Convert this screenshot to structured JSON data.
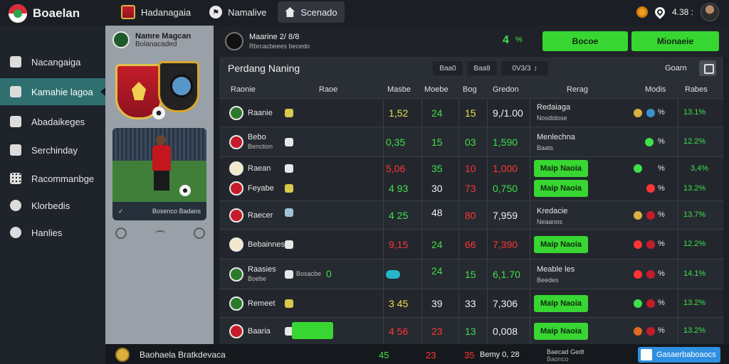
{
  "brand": {
    "name": "Boaelan"
  },
  "topnav": [
    {
      "label": "Hadanagaia"
    },
    {
      "label": "Namalive"
    },
    {
      "label": "Scenado"
    }
  ],
  "topright": {
    "balance": "4.38 :"
  },
  "sidebar": {
    "items": [
      {
        "label": "Nacangaiga"
      },
      {
        "label": "Kamahie lagoa"
      },
      {
        "label": "Abadaikeges"
      },
      {
        "label": "Serchinday"
      },
      {
        "label": "Racommanbge"
      },
      {
        "label": "Klorbedis"
      },
      {
        "label": "Hanlies"
      }
    ],
    "active_index": 1
  },
  "match_panel": {
    "title": "Namre Magcan",
    "subtitle": "Bolanacaded",
    "card_caption": "Bosenco Badaos"
  },
  "match_header": {
    "title": "Maarine 2/ 8/8",
    "subtitle": "Rbrcacbeees becedo",
    "odds": "4",
    "odds_pct": "%",
    "btn_primary": "Bocoe",
    "btn_secondary": "Mionaeie"
  },
  "table": {
    "title": "Perdang Naning",
    "filters": [
      "Baa0",
      "Baa8",
      "0V3/3"
    ],
    "search_label": "Goarn",
    "columns": [
      "Raonie",
      "Raoe",
      "Masbe",
      "Moebe",
      "Bog",
      "Gredon",
      "Rerag",
      "Modis",
      "Rabes"
    ],
    "rows": [
      {
        "team": "Raanie",
        "team2": "",
        "c1": "1,52",
        "c2": "24",
        "c3": "15",
        "c4": "9,/1.00",
        "info": "Redaiaga",
        "info_sub": "Nosdidose",
        "btn": "",
        "mod": "%",
        "rate": "13.1%"
      },
      {
        "team": "Bebo",
        "team2": "Benction",
        "c1": "0,35",
        "c2": "15",
        "c3": "03",
        "c4": "1,590",
        "info": "Menlechna",
        "info_sub": "Baats",
        "btn": "",
        "mod": "%",
        "rate": "12.2%"
      },
      {
        "team": "Raean",
        "team2": "Feyabe",
        "c1": "5,06",
        "c1b": "4 93",
        "c2": "35",
        "c2b": "30",
        "c3": "10",
        "c3b": "73",
        "c4": "1,000",
        "c4b": "0,750",
        "info": "",
        "info_sub": "",
        "btn": "Maip Naoia",
        "btn2": "Maip Naoia",
        "mod": "%",
        "mod2": "%",
        "rate": "3,4%",
        "rate2": "13.2%"
      },
      {
        "team": "Raecer",
        "team2": "",
        "c1": "4 25",
        "c2": "48",
        "c3": "80",
        "c4": "7,959",
        "info": "Kredacie",
        "info_sub": "Neaanos",
        "btn": "",
        "mod": "%",
        "rate": "13.7%"
      },
      {
        "team": "Bebainnes",
        "team2": "",
        "c1": "9,15",
        "c2": "24",
        "c3": "66",
        "c4": "7,390",
        "info": "",
        "info_sub": "",
        "btn": "Maip Naoia",
        "mod": "%",
        "rate": "12.2%"
      },
      {
        "team": "Raasies",
        "team2": "Boebe",
        "c1": "",
        "c2": "24",
        "c3": "15",
        "c4": "6,1.70",
        "info": "Meable les",
        "info_sub": "Beedes",
        "btn": "",
        "mod": "%",
        "rate": "14.1%",
        "badge_text": "Bosacbe",
        "badge_num": "0"
      },
      {
        "team": "Remeet",
        "team2": "",
        "c1": "3 45",
        "c2": "39",
        "c3": "33",
        "c4": "7,306",
        "info": "",
        "info_sub": "",
        "btn": "Maip Naoia",
        "mod": "%",
        "rate": "13.2%"
      },
      {
        "team": "Baaria",
        "team2": "",
        "c1": "4 56",
        "c2": "23",
        "c3": "13",
        "c4": "0,008",
        "info": "",
        "info_sub": "",
        "btn": "Maip Naoia",
        "mod": "%",
        "rate": "13.2%"
      }
    ]
  },
  "bottombar": {
    "title": "Baohaela Bratkdevaca",
    "v1": "45",
    "v2": "23",
    "v3": "35",
    "v4": "Bemy 0, 28",
    "v5": "Baecad Gedt",
    "v5b": "Baonco",
    "button": "Gasaerbaboaocs"
  },
  "colors": {
    "accent_green": "#38d632",
    "accent_teal": "#2f6f6f",
    "accent_blue": "#2f8fe0",
    "positive": "#3fe04a",
    "negative": "#ff3434"
  },
  "icons": {
    "top_nav_1": "crest-icon",
    "top_nav_2": "flag-icon",
    "top_nav_3": "home-icon",
    "top_right_1": "coin-icon",
    "top_right_2": "location-pin-icon"
  }
}
